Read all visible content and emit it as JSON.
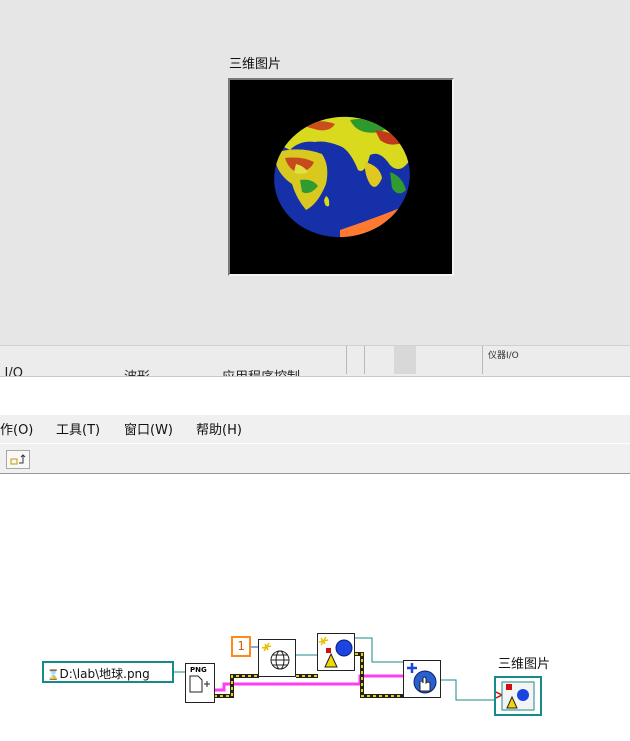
{
  "front_panel": {
    "indicator_label": "三维图片"
  },
  "palette_strip": {
    "cut_labels": [
      "... I/O",
      "波形",
      "应用程序控制"
    ],
    "inst_io_label": "仪器I/O"
  },
  "menubar": {
    "items": [
      "作(O)",
      "工具(T)",
      "窗口(W)",
      "帮助(H)"
    ]
  },
  "block_diagram": {
    "path_constant": "D:\\lab\\地球.png",
    "numeric_constant": "1",
    "terminal_label": "三维图片",
    "png_node_label": "PNG"
  },
  "colors": {
    "panel_bg": "#e6e6e6",
    "path_wire": "#178a8a",
    "cluster_wire": "#ff3cf0",
    "numeric_border": "#ff8a1c"
  },
  "icons": [
    "globe-icon",
    "scene-object-icon",
    "sphere-icon",
    "add-object-icon",
    "hand-icon",
    "scene-terminal-icon"
  ]
}
